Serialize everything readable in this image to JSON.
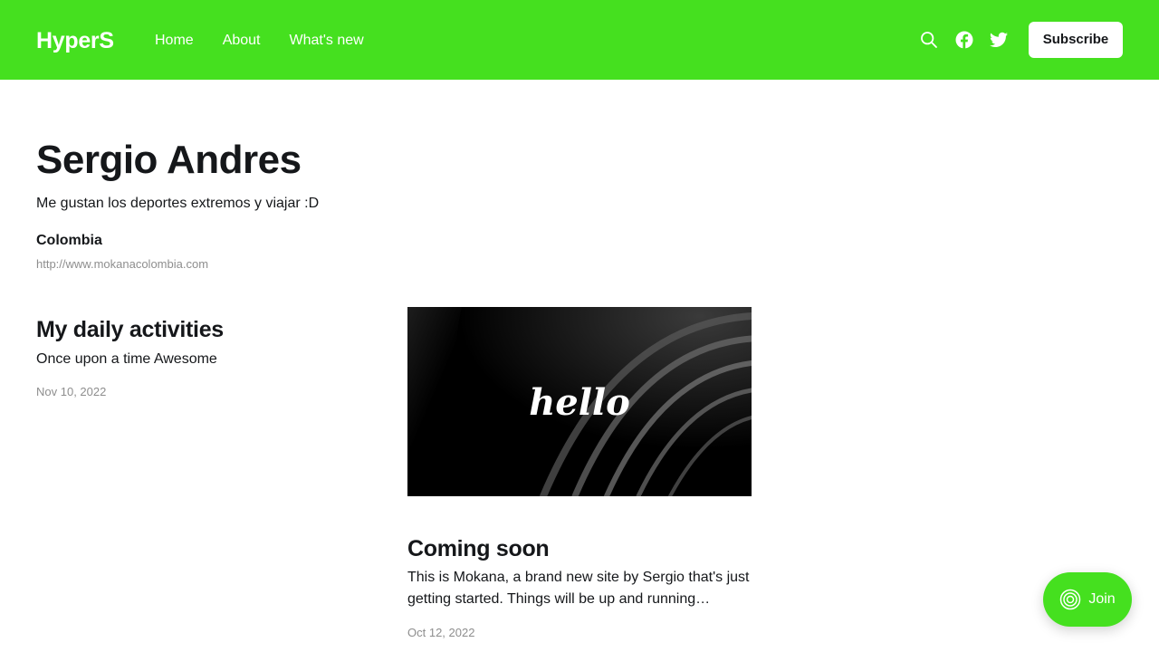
{
  "site": {
    "logo": "HyperS",
    "accent_color": "#45e01f"
  },
  "nav": {
    "links": [
      "Home",
      "About",
      "What's new"
    ],
    "icons": [
      "search-icon",
      "facebook-icon",
      "twitter-icon"
    ],
    "subscribe_label": "Subscribe"
  },
  "author": {
    "name": "Sergio Andres",
    "bio": "Me gustan los deportes extremos y viajar :D",
    "location": "Colombia",
    "website": "http://www.mokanacolombia.com"
  },
  "posts": [
    {
      "title": "My daily activities",
      "excerpt": "Once upon a time Awesome",
      "date": "Nov 10, 2022"
    },
    {
      "title": "Coming soon",
      "excerpt": "This is Mokana, a brand new site by Sergio that's just getting started. Things will be up and running…",
      "date": "Oct 12, 2022",
      "image_text": "hello"
    }
  ],
  "portal": {
    "join_label": "Join"
  }
}
